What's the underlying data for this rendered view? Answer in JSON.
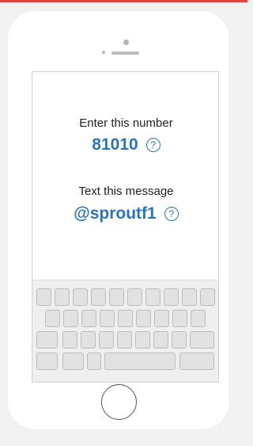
{
  "colors": {
    "accent": "#2d73b8",
    "top_bar": "#e0463b",
    "background": "#f2f2f2"
  },
  "instructions": {
    "number_label": "Enter this number",
    "number_value": "81010",
    "message_label": "Text this message",
    "message_value": "@sproutf1",
    "help_glyph": "?"
  },
  "icons": {
    "help": "question-circle-icon",
    "home": "home-button",
    "camera": "camera"
  },
  "keyboard": {
    "row_key_counts": [
      10,
      9,
      7,
      4
    ]
  }
}
